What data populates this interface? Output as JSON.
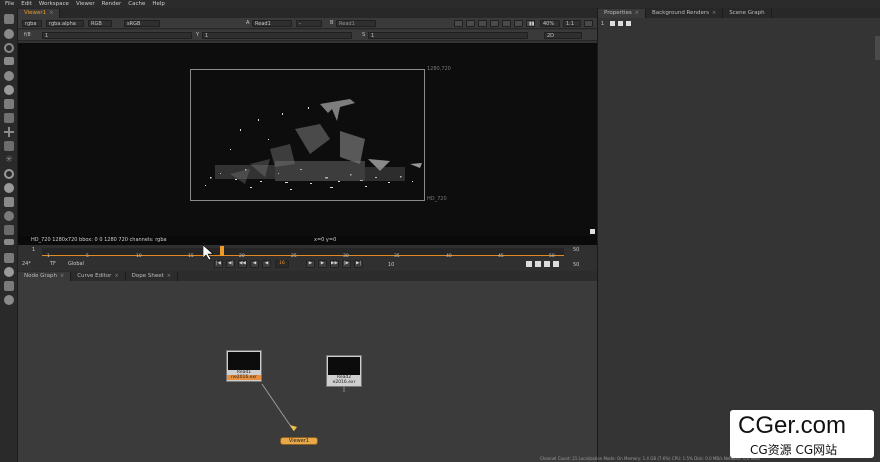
{
  "menubar": [
    "File",
    "Edit",
    "Workspace",
    "Viewer",
    "Render",
    "Cache",
    "Help"
  ],
  "viewer": {
    "tab_label": "Viewer1",
    "channels": "rgba",
    "alpha_channel": "rgba.alpha",
    "colorspace": "RGB",
    "lut": "sRGB",
    "input_a_label": "A",
    "input_a": "Read1",
    "blend": "-",
    "input_b_label": "B",
    "input_b": "Read1",
    "zoom": "40%",
    "proxy": "1:1",
    "fstop_label": "f/8",
    "gain": "1",
    "gamma_y_label": "Y",
    "gamma": "1",
    "saturation_label": "S",
    "saturation": "1",
    "view_mode": "2D",
    "format_label": "1280,720",
    "format_bottom_label": "HD_720",
    "info_left": "HD_720 1280x720  bbox: 0 0 1280 720 channels: rgba",
    "info_right": "x=0 y=0"
  },
  "timeline": {
    "start_frame": "1",
    "end_frame": "50",
    "current_frame": "16",
    "ticks": [
      "1",
      "5",
      "10",
      "15",
      "20",
      "25",
      "30",
      "35",
      "40",
      "45",
      "50"
    ],
    "fps": "24*",
    "tf": "TF",
    "global": "Global",
    "increment": "10",
    "end_field": "50",
    "transport_buttons": [
      "|◀",
      "◀|",
      "◀◀",
      "◀",
      "◀",
      "16",
      "▶",
      "▶",
      "▶▶",
      "|▶",
      "▶|"
    ]
  },
  "bottom_tabs": [
    "Node Graph",
    "Curve Editor",
    "Dope Sheet"
  ],
  "nodes": {
    "read1_name": "Read1",
    "read1_file": "ne2016.exr",
    "read2_name": "Read2",
    "read2_file": "e2016.exr",
    "viewer_name": "Viewer1"
  },
  "right_tabs": [
    "Properties",
    "Background Renders",
    "Scene Graph"
  ],
  "right_toolbar_count": "1",
  "status": "Channel Count: 21  Localization Mode: On  Memory: 1.4 GB (7.6%)  CPU: 1.5%  Disk: 0.0 MB/s  Network: 0.0 MB/s",
  "watermark": {
    "title": "CGer.com",
    "subtitle": "CG资源  CG网站"
  },
  "colors": {
    "accent": "#f09a2a",
    "node_viewer": "#e8a84a"
  }
}
